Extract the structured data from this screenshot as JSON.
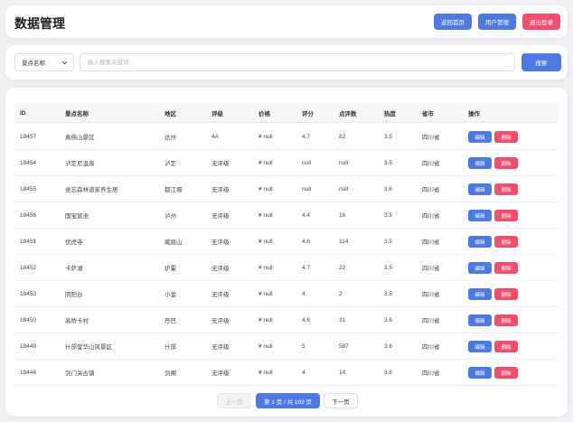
{
  "header": {
    "title": "数据管理",
    "buttons": {
      "home": "返回首页",
      "users": "用户管理",
      "logout": "退出登录"
    }
  },
  "search": {
    "field_select": "景点名称",
    "placeholder": "输入搜索关键词...",
    "button": "搜索"
  },
  "table": {
    "columns": [
      "ID",
      "景点名称",
      "地区",
      "评级",
      "价格",
      "评分",
      "点评数",
      "热度",
      "省市",
      "操作"
    ],
    "rows": [
      [
        "18457",
        "真佛山景区",
        "达州",
        "4A",
        "¥ null",
        "4.7",
        "82",
        "3.5",
        "四川省"
      ],
      [
        "18454",
        "泸定尼温泉",
        "泸定",
        "无评级",
        "¥ null",
        "null",
        "null",
        "3.5",
        "四川省"
      ],
      [
        "18455",
        "坐忘森林道家养生居",
        "都江堰",
        "无评级",
        "¥ null",
        "null",
        "null",
        "3.6",
        "四川省"
      ],
      [
        "18456",
        "国宝窖池",
        "泸州",
        "无评级",
        "¥ null",
        "4.4",
        "16",
        "3.5",
        "四川省"
      ],
      [
        "18451",
        "伏虎寺",
        "峨眉山",
        "无评级",
        "¥ null",
        "4.6",
        "114",
        "3.5",
        "四川省"
      ],
      [
        "18452",
        "卡萨湖",
        "炉霍",
        "无评级",
        "¥ null",
        "4.7",
        "22",
        "3.5",
        "四川省"
      ],
      [
        "18453",
        "阴阳台",
        "小金",
        "无评级",
        "¥ null",
        "4",
        "2",
        "3.5",
        "四川省"
      ],
      [
        "18450",
        "高桥卡村",
        "丹巴",
        "无评级",
        "¥ null",
        "4.6",
        "31",
        "3.6",
        "四川省"
      ],
      [
        "18449",
        "什邡蓥华山风景区",
        "什邡",
        "无评级",
        "¥ null",
        "5",
        "587",
        "3.6",
        "四川省"
      ],
      [
        "18446",
        "剑门关古镇",
        "剑阁",
        "无评级",
        "¥ null",
        "4",
        "14",
        "3.6",
        "四川省"
      ]
    ],
    "actions": {
      "edit": "编辑",
      "delete": "删除"
    }
  },
  "pagination": {
    "prev": "上一页",
    "current": "第 1 页 / 共 102 页",
    "next": "下一页"
  },
  "colors": {
    "primary": "#4d7ae0",
    "danger": "#f0506e",
    "background": "#eef0f4"
  }
}
